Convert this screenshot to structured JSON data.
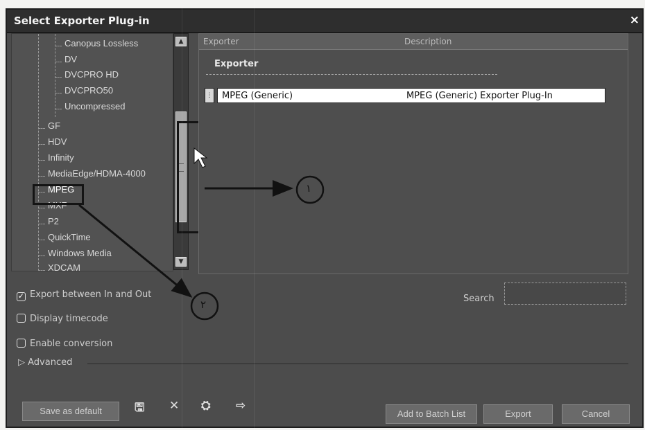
{
  "dialog": {
    "title": "Select Exporter Plug-in",
    "close_glyph": "×"
  },
  "tree": {
    "items": [
      {
        "label": "Canopus Lossless"
      },
      {
        "label": "DV"
      },
      {
        "label": "DVCPRO HD"
      },
      {
        "label": "DVCPRO50"
      },
      {
        "label": "Uncompressed"
      },
      {
        "label": "GF"
      },
      {
        "label": "HDV"
      },
      {
        "label": "Infinity"
      },
      {
        "label": "MediaEdge/HDMA-4000"
      },
      {
        "label": "MPEG"
      },
      {
        "label": "MXF"
      },
      {
        "label": "P2"
      },
      {
        "label": "QuickTime"
      },
      {
        "label": "Windows Media"
      },
      {
        "label": "XDCAM"
      }
    ],
    "selected": "MPEG"
  },
  "table": {
    "col_exporter": "Exporter",
    "col_description": "Description",
    "group_label": "Exporter",
    "rows": [
      {
        "exporter": "MPEG (Generic)",
        "description": "MPEG (Generic) Exporter Plug-In"
      }
    ]
  },
  "options": {
    "export_between": {
      "label": "Export between In and Out",
      "checked": true,
      "check_glyph": "✓"
    },
    "display_timecode": {
      "label": "Display timecode",
      "checked": false
    },
    "enable_conversion": {
      "label": "Enable conversion",
      "checked": false
    },
    "advanced": {
      "label": "Advanced",
      "glyph": "▷"
    }
  },
  "search": {
    "label": "Search",
    "value": ""
  },
  "buttons": {
    "save_default": "Save as default",
    "add_batch": "Add to Batch List",
    "export": "Export",
    "cancel": "Cancel"
  },
  "toolbar_icons": {
    "save": "🖫",
    "delete": "✕",
    "import": "⛭",
    "export": "⇨"
  },
  "callouts": {
    "one": "١",
    "two": "٢"
  },
  "colors": {
    "dialog_bg": "#4c4c4c",
    "title_bg": "#2e2e2e",
    "row_bg": "#ffffff"
  }
}
